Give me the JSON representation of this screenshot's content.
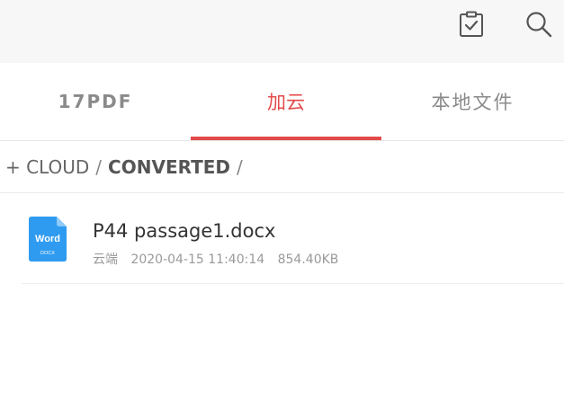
{
  "topbar": {
    "icons": [
      "clipboard-check-icon",
      "search-icon"
    ]
  },
  "tabs": [
    {
      "label": "17PDF",
      "active": false
    },
    {
      "label": "加云",
      "active": true
    },
    {
      "label": "本地文件",
      "active": false
    }
  ],
  "colors": {
    "accent": "#e44a4a",
    "word_icon": "#2e9bf0",
    "topbar_bg": "#f7f7f7"
  },
  "breadcrumb": {
    "root": "+ CLOUD",
    "separator": "/",
    "current": "CONVERTED"
  },
  "files": [
    {
      "icon_type": "Word",
      "icon_ext": "DOCX",
      "name": "P44 passage1.docx",
      "location": "云端",
      "date": "2020-04-15 11:40:14",
      "size": "854.40KB"
    }
  ]
}
